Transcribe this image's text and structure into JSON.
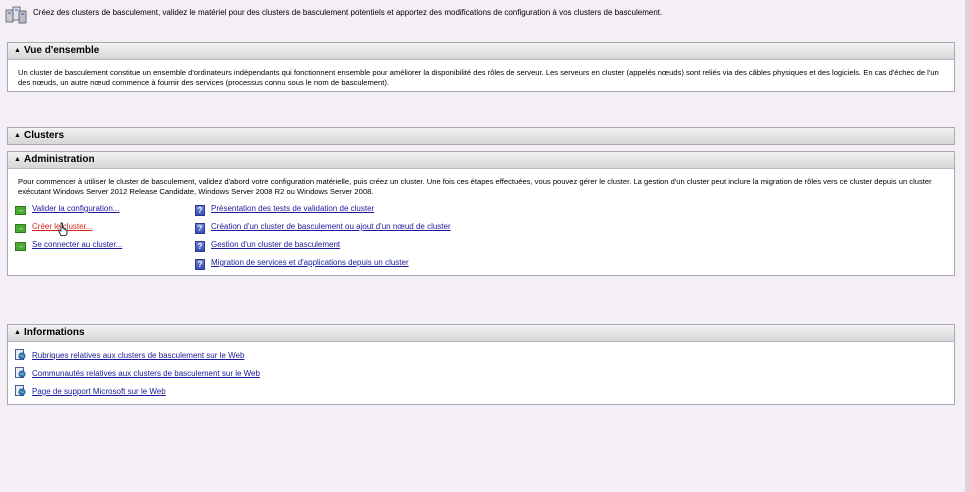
{
  "header": {
    "description": "Créez des clusters de basculement, validez le matériel pour des clusters de basculement potentiels et apportez des modifications de configuration à vos clusters de basculement.",
    "logo_icon": "cluster-servers-icon"
  },
  "overview": {
    "title": "Vue d'ensemble",
    "text": "Un cluster de basculement constitue un ensemble d'ordinateurs indépendants qui fonctionnent ensemble pour améliorer la disponibilité des rôles de serveur. Les serveurs en cluster (appelés nœuds) sont reliés via des câbles physiques et des logiciels. En cas d'échec de l'un des nœuds, un autre nœud commence à fournir des services (processus connu sous le nom de basculement)."
  },
  "clusters": {
    "title": "Clusters"
  },
  "administration": {
    "title": "Administration",
    "text": "Pour commencer à utiliser le cluster de basculement, validez d'abord votre configuration matérielle, puis créez un cluster. Une fois ces étapes effectuées, vous pouvez gérer le cluster. La gestion d'un cluster peut inclure la migration de rôles vers ce cluster depuis un cluster exécutant Windows Server 2012 Release Candidate, Windows Server 2008 R2 ou Windows Server 2008.",
    "actions": [
      {
        "label": "Valider la configuration...",
        "icon": "green-arrow-icon"
      },
      {
        "label": "Créer le cluster...",
        "icon": "green-arrow-icon"
      },
      {
        "label": "Se connecter au cluster...",
        "icon": "green-arrow-icon"
      }
    ],
    "help_links": [
      {
        "label": "Présentation des tests de validation de cluster",
        "icon": "help-icon"
      },
      {
        "label": "Création d'un cluster de basculement ou ajout d'un nœud de cluster",
        "icon": "help-icon"
      },
      {
        "label": "Gestion d'un cluster de basculement",
        "icon": "help-icon"
      },
      {
        "label": "Migration de services et d'applications depuis un cluster",
        "icon": "help-icon"
      }
    ]
  },
  "informations": {
    "title": "Informations",
    "links": [
      {
        "label": "Rubriques relatives aux clusters de basculement sur le Web",
        "icon": "web-page-icon"
      },
      {
        "label": "Communautés relatives aux clusters de basculement sur le Web",
        "icon": "web-page-icon"
      },
      {
        "label": "Page de support Microsoft sur le Web",
        "icon": "web-page-icon"
      }
    ]
  },
  "colors": {
    "link": "#1a1a9a",
    "link_active": "#d0261b",
    "background": "#f4eef6"
  }
}
